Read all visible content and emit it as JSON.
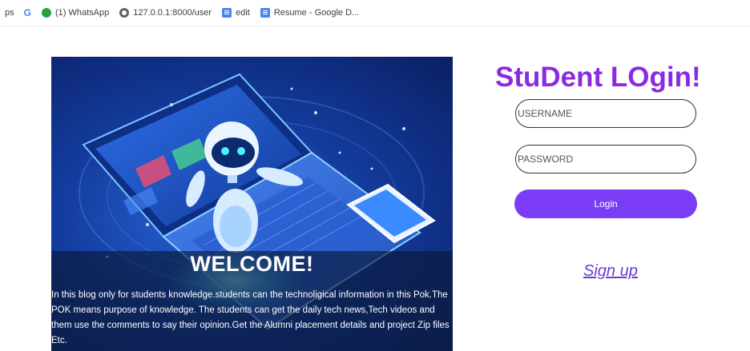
{
  "bookmarks": {
    "items": [
      {
        "label": "ps",
        "icon": "apps-icon"
      },
      {
        "label": "",
        "icon": "google-icon"
      },
      {
        "label": "(1) WhatsApp",
        "icon": "whatsapp-icon"
      },
      {
        "label": "127.0.0.1:8000/user",
        "icon": "globe-icon"
      },
      {
        "label": "edit",
        "icon": "doc-icon"
      },
      {
        "label": "Resume - Google D...",
        "icon": "doc-icon"
      }
    ]
  },
  "hero": {
    "heading": "WELCOME!",
    "description": "In this blog only for students knowledge.students can the technoligical information in this Pok.The POK means purpose of knowledge. The students can get the daily tech news,Tech videos and them use the comments to say their opinion.Get the Alumni placement details and project Zip files Etc."
  },
  "login": {
    "title": "StuDent LOgin!",
    "username_placeholder": "USERNAME",
    "password_placeholder": "PASSWORD",
    "button_label": "Login",
    "signup_label": "Sign up"
  },
  "colors": {
    "title": "#8a2be2",
    "button": "#7b3cf6",
    "signup": "#6a3bd8",
    "hero_bg": "#133c9e"
  }
}
